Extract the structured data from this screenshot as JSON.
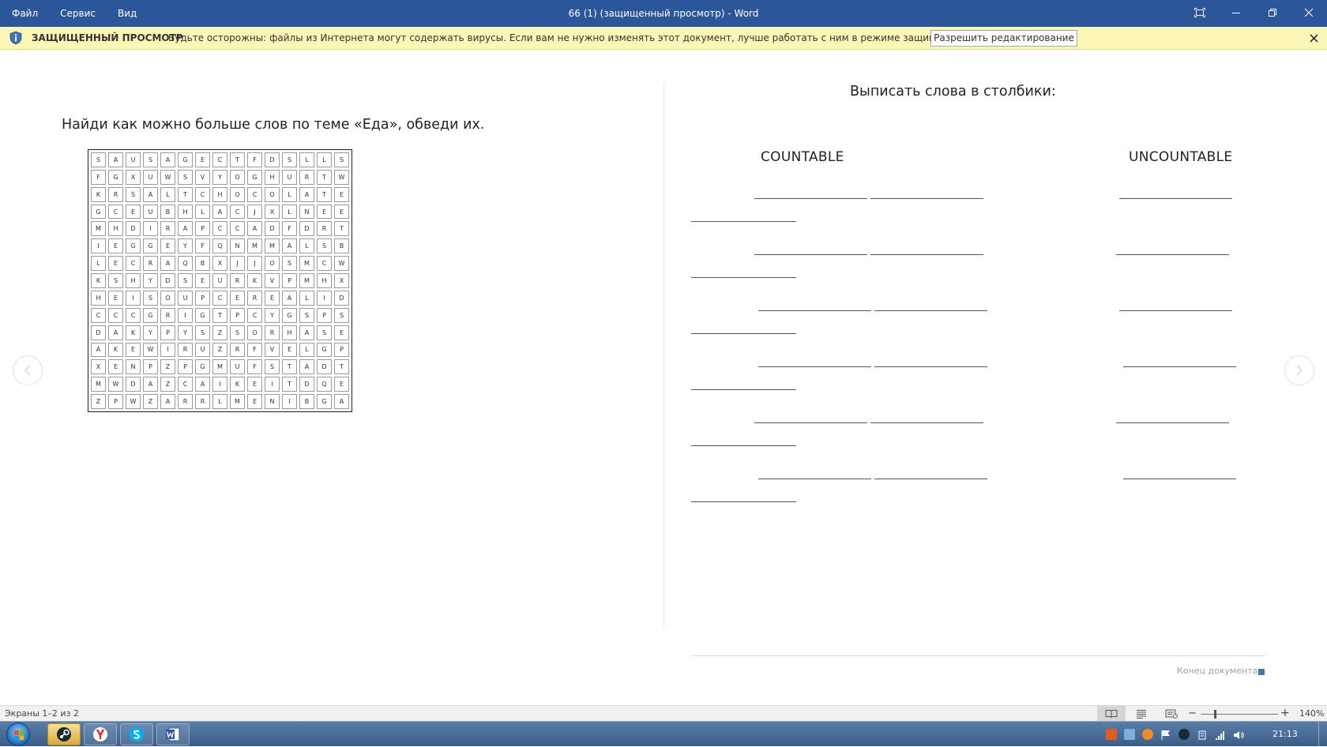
{
  "titlebar": {
    "menus": [
      "Файл",
      "Сервис",
      "Вид"
    ],
    "title": "66 (1) (защищенный просмотр) - Word"
  },
  "protected_view": {
    "title": "ЗАЩИЩЕННЫЙ ПРОСМОТР",
    "message": "Будьте осторожны: файлы из Интернета могут содержать вирусы. Если вам не нужно изменять этот документ, лучше работать с ним в режиме защищенного просмотра.",
    "button": "Разрешить редактирование"
  },
  "document": {
    "left_title": "Найди как можно больше слов по теме «Еда», обведи их.",
    "grid_rows": [
      "SAUSAGECTFDSLLS",
      "FGXUWSVYOGHURTW",
      "KRSALTCHOCOLATE",
      "GCEUBHLACJXLNEE",
      "MHDIRAPCCADFDRT",
      "IEGGEYFQNMMALSB",
      "LECRAQBXJJOSMCW",
      "KSHYDSEURKVPMHX",
      "HEISOUPCEREALID",
      "CCCGRIGTPCYGSPS",
      "DAKYPYSZSORHASE",
      "AKEWIRUZRFVELGP",
      "XENPZPGMUFSTADT",
      "MWDAZCAIKEITDQE",
      "ZPWZARRLMENIBGA"
    ],
    "right_title": "Выписать слова в столбики:",
    "countable_label": "COUNTABLE",
    "uncountable_label": "UNCOUNTABLE",
    "end_label": "Конец документа"
  },
  "statusbar": {
    "pages": "Экраны 1–2 из 2",
    "zoom_minus": "−",
    "zoom_plus": "+",
    "zoom": "140%"
  },
  "taskbar": {
    "clock": "21:13",
    "apps": [
      "steam",
      "yandex-browser",
      "skype",
      "word"
    ]
  },
  "colors": {
    "title_bar": "#2b579a",
    "protected_bar": "#fcf7b6",
    "accent": "#4a72b0"
  }
}
